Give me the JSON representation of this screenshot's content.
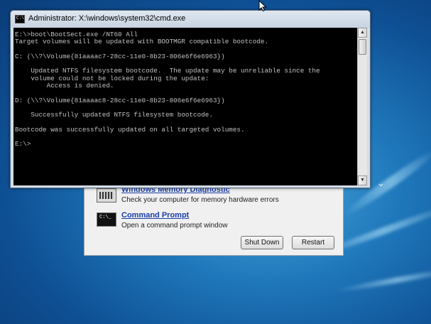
{
  "cmd_window": {
    "title": "Administrator: X:\\windows\\system32\\cmd.exe",
    "icon_label": "C:\\",
    "console_lines": [
      "E:\\>boot\\BootSect.exe /NT60 All",
      "Target volumes will be updated with BOOTMGR compatible bootcode.",
      "",
      "C: (\\\\?\\Volume{81aaaac7-28cc-11e0-8b23-806e6f6e6963})",
      "",
      "    Updated NTFS filesystem bootcode.  The update may be unreliable since the",
      "    volume could not be locked during the update:",
      "        Access is denied.",
      "",
      "D: (\\\\?\\Volume{81aaaac8-28cc-11e0-8b23-806e6f6e6963})",
      "",
      "    Successfully updated NTFS filesystem bootcode.",
      "",
      "Bootcode was successfully updated on all targeted volumes.",
      "",
      "E:\\>"
    ],
    "scroll_up": "▲",
    "scroll_down": "▼"
  },
  "recovery": {
    "items": [
      {
        "title": "Windows Memory Diagnostic",
        "description": "Check your computer for memory hardware errors"
      },
      {
        "title": "Command Prompt",
        "description": "Open a command prompt window",
        "icon_label": "C:\\_"
      }
    ],
    "shutdown_label": "Shut Down",
    "restart_label": "Restart"
  }
}
